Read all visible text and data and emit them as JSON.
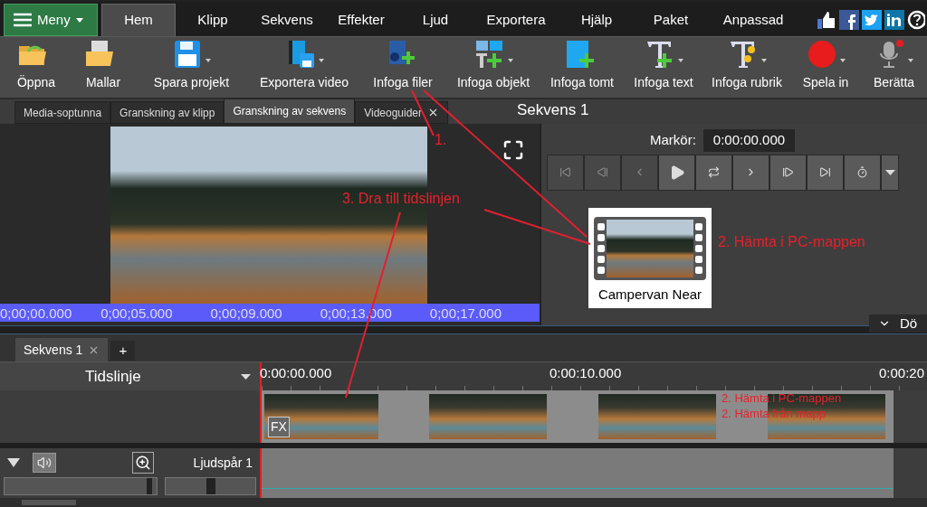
{
  "menu_button": {
    "label": "Meny"
  },
  "menu_tabs": [
    {
      "label": "Hem",
      "selected": true
    },
    {
      "label": "Klipp",
      "selected": false
    },
    {
      "label": "Sekvens",
      "selected": false
    },
    {
      "label": "Effekter",
      "selected": false
    },
    {
      "label": "Ljud",
      "selected": false
    },
    {
      "label": "Exportera",
      "selected": false
    },
    {
      "label": "Hjälp",
      "selected": false
    },
    {
      "label": "Paket",
      "selected": false
    },
    {
      "label": "Anpassad",
      "selected": false
    }
  ],
  "toolbar": [
    {
      "label": "Öppna",
      "dropdown": false
    },
    {
      "label": "Mallar",
      "dropdown": false
    },
    {
      "label": "Spara projekt",
      "dropdown": true
    },
    {
      "label": "Exportera video",
      "dropdown": true
    },
    {
      "label": "Infoga filer",
      "dropdown": false
    },
    {
      "label": "Infoga objekt",
      "dropdown": true
    },
    {
      "label": "Infoga tomt",
      "dropdown": false
    },
    {
      "label": "Infoga text",
      "dropdown": true
    },
    {
      "label": "Infoga rubrik",
      "dropdown": true
    },
    {
      "label": "Spela in",
      "dropdown": true
    },
    {
      "label": "Berätta",
      "dropdown": true
    }
  ],
  "panel_tabs": [
    {
      "label": "Media-soptunna",
      "selected": false,
      "closable": false
    },
    {
      "label": "Granskning av klipp",
      "selected": false,
      "closable": false
    },
    {
      "label": "Granskning av sekvens",
      "selected": true,
      "closable": false
    },
    {
      "label": "Videoguider",
      "selected": false,
      "closable": true
    }
  ],
  "panel_title": "Sekvens 1",
  "preview": {
    "ruler_labels": [
      "0;00;00.000",
      "0;00;05.000",
      "0;00;09.000",
      "0;00;13.000",
      "0;00;17.000"
    ]
  },
  "player": {
    "cursor_label": "Markör:",
    "cursor_value": "0:00:00.000",
    "transport_buttons": [
      {
        "disabled": true
      },
      {
        "disabled": true
      },
      {
        "disabled": true
      },
      {
        "disabled": false
      },
      {
        "disabled": false
      },
      {
        "disabled": false
      },
      {
        "disabled": false
      },
      {
        "disabled": false
      },
      {
        "disabled": false
      }
    ]
  },
  "clip_card": {
    "name": "Campervan Near"
  },
  "dock_tab": {
    "label": "Dö"
  },
  "annotations": [
    {
      "text": "1."
    },
    {
      "text": "3. Dra till tidslinjen"
    },
    {
      "text": "2. Hämta i PC-mappen"
    },
    {
      "text": "2. Hämta i PC-mappen"
    },
    {
      "text": "2. Hämta från mapp"
    }
  ],
  "sequence_tabs": [
    {
      "label": "Sekvens 1",
      "selected": true,
      "closable": true
    }
  ],
  "add_tab": "+",
  "timeline": {
    "label": "Tidslinje",
    "ruler_labels": [
      "0:00:00.000",
      "0:00:10.000",
      "0:00:20"
    ],
    "fx_badge": "FX",
    "clips": [
      {
        "fx": true
      },
      {
        "fx": false
      },
      {
        "fx": false
      },
      {
        "fx": false
      }
    ]
  },
  "audio_track": {
    "name": "Ljudspår 1",
    "volume": {
      "level": 0.97
    },
    "pan": {
      "level": 0.5
    }
  }
}
